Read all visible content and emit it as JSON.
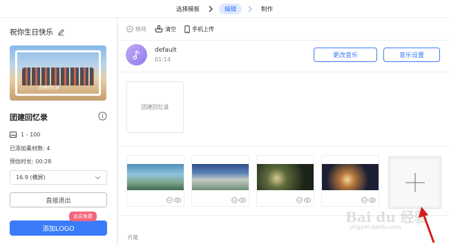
{
  "stepper": {
    "steps": [
      "选择模板",
      "编辑",
      "制作"
    ],
    "active_index": 1
  },
  "sidebar": {
    "project_title": "祝你生日快乐",
    "thumbnail_caption": "团建回忆录",
    "set_name": "团建回忆录",
    "material_range": "1 - 100",
    "added_count": "已添加素材数: 4",
    "duration": "预估时长: 00:28",
    "ratio_select": "16.9 (横屏)",
    "exit_button": "直接退出",
    "logo_button": "添加LOGO",
    "free_badge": "会员免费"
  },
  "toolbar": {
    "remove": "移除",
    "clear": "清空",
    "phone_upload": "手机上传"
  },
  "music": {
    "name": "default",
    "time": "01:14",
    "change_button": "更改音乐",
    "settings_button": "音乐设置"
  },
  "intro_card": {
    "label": "团建回忆录"
  },
  "outro": {
    "label": "片尾"
  },
  "watermark": {
    "main": "Bai du 经验",
    "sub": "jingyan.baidu.com"
  },
  "colors": {
    "accent": "#3a7bf9",
    "badge": "#f5647b",
    "active_step_bg": "#dfe9ff"
  }
}
